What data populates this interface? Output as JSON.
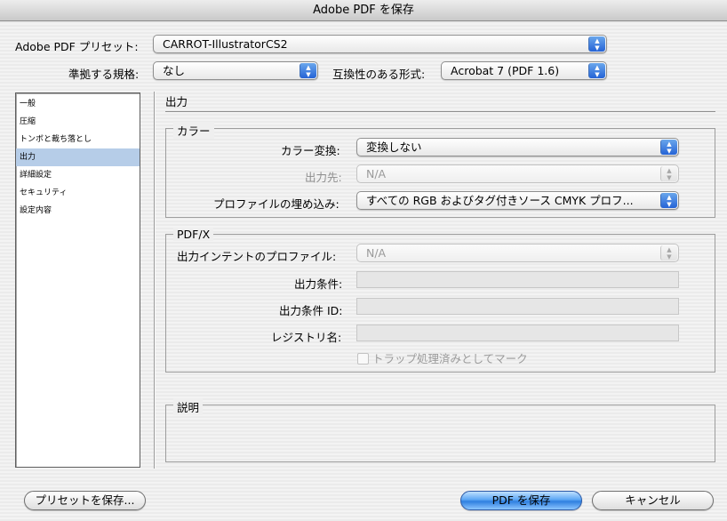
{
  "window": {
    "title": "Adobe PDF を保存"
  },
  "preset": {
    "label": "Adobe PDF プリセット:",
    "value": "CARROT-IllustratorCS2"
  },
  "standard": {
    "label": "準拠する規格:",
    "value": "なし"
  },
  "compat": {
    "label": "互換性のある形式:",
    "value": "Acrobat 7 (PDF 1.6)"
  },
  "sidebar": {
    "items": [
      {
        "label": "一般"
      },
      {
        "label": "圧縮"
      },
      {
        "label": "トンボと裁ち落とし"
      },
      {
        "label": "出力"
      },
      {
        "label": "詳細設定"
      },
      {
        "label": "セキュリティ"
      },
      {
        "label": "設定内容"
      }
    ],
    "selected_index": 3
  },
  "main": {
    "title": "出力",
    "color": {
      "title": "カラー",
      "conversion_label": "カラー変換:",
      "conversion_value": "変換しない",
      "destination_label": "出力先:",
      "destination_value": "N/A",
      "profile_label": "プロファイルの埋め込み:",
      "profile_value": "すべての RGB およびタグ付きソース CMYK プロフ..."
    },
    "pdfx": {
      "title": "PDF/X",
      "intent_label": "出力インテントのプロファイル:",
      "intent_value": "N/A",
      "condition_label": "出力条件:",
      "condition_id_label": "出力条件 ID:",
      "registry_label": "レジストリ名:",
      "trapped_label": "トラップ処理済みとしてマーク"
    },
    "description": {
      "title": "説明"
    }
  },
  "buttons": {
    "save_preset": "プリセットを保存...",
    "save_pdf": "PDF を保存",
    "cancel": "キャンセル"
  },
  "colors": {
    "accent": "#3d8ae8",
    "selection": "#b6cde8"
  }
}
